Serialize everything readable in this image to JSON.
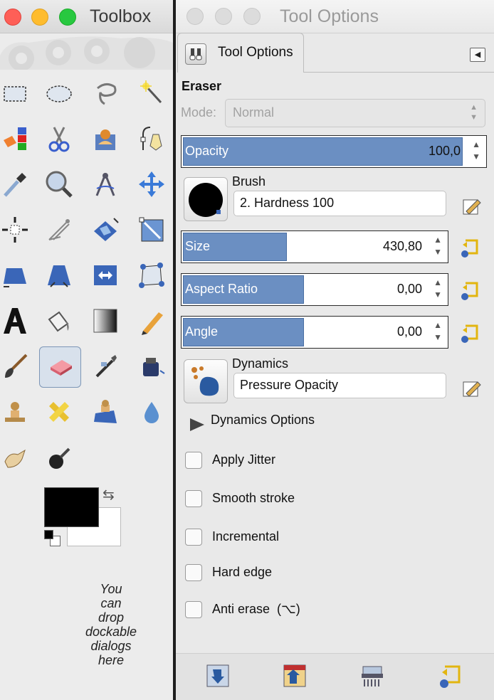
{
  "toolbox": {
    "title": "Toolbox",
    "drop_hint": "You\ncan\ndrop\ndockable\ndialogs\nhere"
  },
  "tool_options": {
    "window_title": "Tool Options",
    "tab_label": "Tool Options",
    "tool_name": "Eraser",
    "mode": {
      "label": "Mode:",
      "value": "Normal"
    },
    "opacity": {
      "label": "Opacity",
      "value": "100,0",
      "fraction": 1.0
    },
    "brush": {
      "label": "Brush",
      "value": "2. Hardness 100"
    },
    "size": {
      "label": "Size",
      "value": "430,80",
      "fraction": 0.41
    },
    "aspect_ratio": {
      "label": "Aspect Ratio",
      "value": "0,00",
      "fraction": 0.5
    },
    "angle": {
      "label": "Angle",
      "value": "0,00",
      "fraction": 0.5
    },
    "dynamics": {
      "label": "Dynamics",
      "value": "Pressure Opacity"
    },
    "dynamics_options_label": "Dynamics Options",
    "checkboxes": [
      {
        "label": "Apply Jitter",
        "checked": false
      },
      {
        "label": "Smooth stroke",
        "checked": false
      },
      {
        "label": "Incremental",
        "checked": false
      },
      {
        "label": "Hard edge",
        "checked": false
      },
      {
        "label": "Anti erase  (⌥)",
        "checked": false
      }
    ]
  },
  "colors": {
    "foreground": "#000000",
    "background": "#ffffff",
    "slider_fill": "#6b8fc2",
    "close": "#fe5f57",
    "minimize": "#febc2e",
    "zoom": "#28c840"
  },
  "icons": {
    "tools": [
      "rect-select-icon",
      "ellipse-select-icon",
      "free-select-icon",
      "fuzzy-select-icon",
      "select-by-color-icon",
      "scissors-select-icon",
      "foreground-select-icon",
      "paths-icon",
      "color-picker-icon",
      "zoom-icon",
      "measure-icon",
      "move-icon",
      "align-icon",
      "crop-icon",
      "unified-transform-icon",
      "handle-transform-icon",
      "perspective-icon",
      "warp-transform-icon",
      "flip-icon",
      "cage-transform-icon",
      "text-icon",
      "bucket-fill-icon",
      "gradient-icon",
      "pencil-icon",
      "paintbrush-icon",
      "eraser-icon",
      "airbrush-icon",
      "ink-icon",
      "clone-icon",
      "heal-icon",
      "perspective-clone-icon",
      "blur-icon",
      "smudge-icon",
      "dodge-burn-icon"
    ],
    "bottom": [
      "save-options-icon",
      "restore-options-icon",
      "delete-options-icon",
      "reset-options-icon"
    ]
  }
}
